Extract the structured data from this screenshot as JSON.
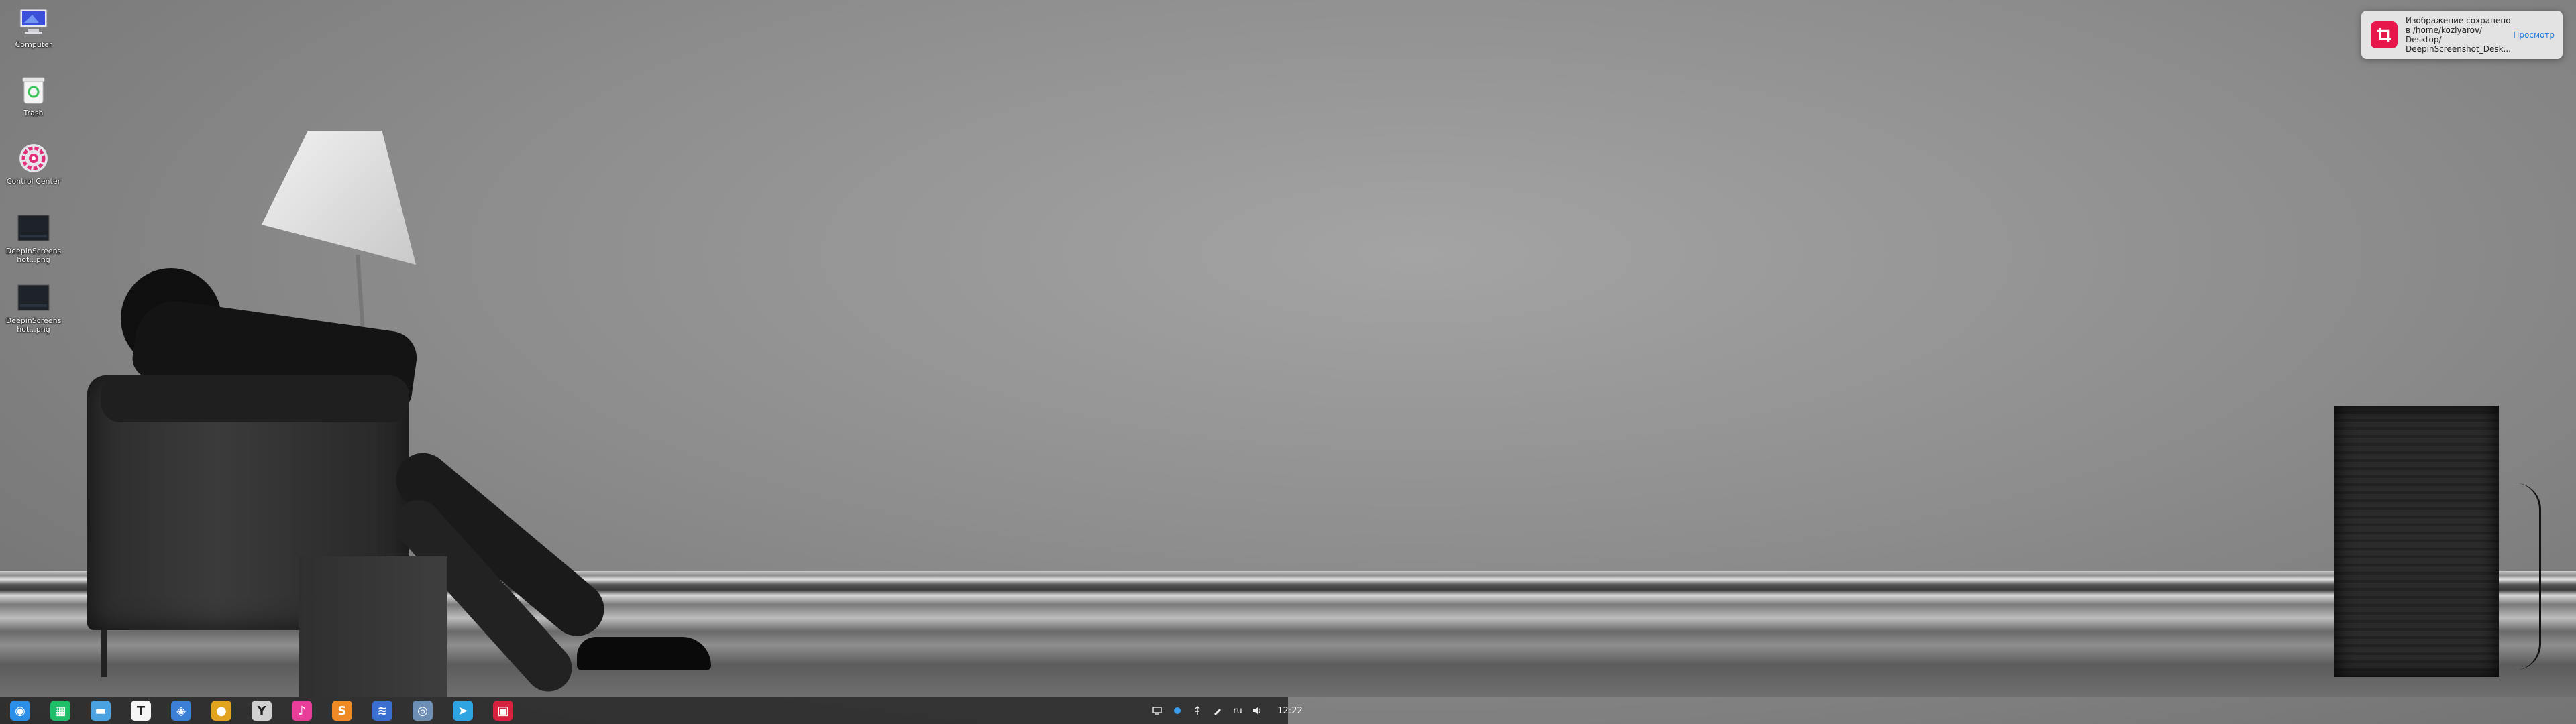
{
  "desktop": {
    "icons": [
      {
        "label": "Computer",
        "icon": "computer-icon"
      },
      {
        "label": "Trash",
        "icon": "trash-icon"
      },
      {
        "label": "Control Center",
        "icon": "settings-gear-icon"
      },
      {
        "label": "DeepinScreenshot...png",
        "icon": "image-file-icon"
      },
      {
        "label": "DeepinScreenshot...png",
        "icon": "image-file-icon"
      }
    ]
  },
  "notification": {
    "line1": "Изображение сохранено",
    "line2": "в /home/kozlyarov/",
    "line3": "Desktop/",
    "line4": "DeepinScreenshot_Desk...",
    "action": "Просмотр",
    "icon": "screenshot-crop-icon",
    "icon_color": "#e8174b"
  },
  "taskbar": {
    "apps": [
      {
        "name": "launcher-icon",
        "glyph": "◉",
        "color": "#2b8fe8"
      },
      {
        "name": "multitasking-icon",
        "glyph": "▦",
        "color": "#1fbf6a"
      },
      {
        "name": "file-manager-icon",
        "glyph": "▬",
        "color": "#4aa3e0"
      },
      {
        "name": "typora-icon",
        "glyph": "T",
        "color": "#f5f5f5"
      },
      {
        "name": "deepin-app-store-icon",
        "glyph": "◈",
        "color": "#3c7fd6"
      },
      {
        "name": "google-chrome-icon",
        "glyph": "●",
        "color": "#e2a31f"
      },
      {
        "name": "yandex-browser-icon",
        "glyph": "Y",
        "color": "#d0d0d0"
      },
      {
        "name": "music-player-icon",
        "glyph": "♪",
        "color": "#e83e9a"
      },
      {
        "name": "sublime-text-icon",
        "glyph": "S",
        "color": "#f08a24"
      },
      {
        "name": "network-monitor-icon",
        "glyph": "≋",
        "color": "#3a6fd0"
      },
      {
        "name": "system-settings-icon",
        "glyph": "◎",
        "color": "#6d8fb5"
      },
      {
        "name": "telegram-icon",
        "glyph": "➤",
        "color": "#2ea5e0"
      },
      {
        "name": "screenshot-icon",
        "glyph": "▣",
        "color": "#d8203f"
      }
    ],
    "tray": {
      "keyboard_layout": "ru",
      "clock": "12:22"
    }
  }
}
